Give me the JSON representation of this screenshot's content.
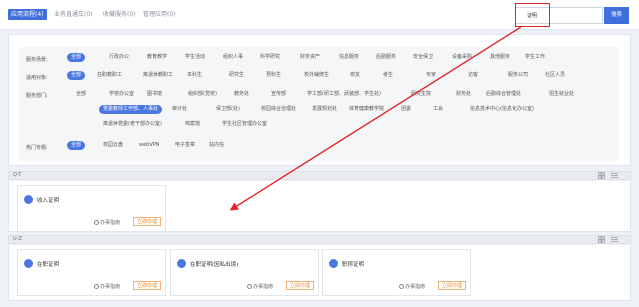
{
  "tabs": [
    {
      "label": "应用流程(4)"
    },
    {
      "label": "业务直通车(0)"
    },
    {
      "label": "收藏服务(0)"
    },
    {
      "label": "管理应用(0)"
    }
  ],
  "search": {
    "value": "证明",
    "button_label": "搜索"
  },
  "filters": {
    "scene_label": "服务场景:",
    "scene_items": [
      "全部",
      "行政办公",
      "教育教学",
      "学生活动",
      "组织人事",
      "科学研究",
      "财务资产",
      "信息服务",
      "后勤服务",
      "安全保卫",
      "设备采购",
      "其他服务",
      "学生工作"
    ],
    "target_label": "适用对象:",
    "target_items": [
      "全部",
      "在职教职工",
      "离退休教职工",
      "本科生",
      "研究生",
      "预科生",
      "校外辅修生",
      "校友",
      "考生",
      "专家",
      "访客",
      "服务公司",
      "社区人员"
    ],
    "dept_label": "服务部门:",
    "dept_row1": [
      "全部",
      "学校办公室",
      "图书馆",
      "组织部(党校)",
      "教务处",
      "宣传部",
      "学工部(研工部、武装部、学生处)",
      "研究生院",
      "财务处",
      "后勤综合管理处",
      "招生就业处"
    ],
    "dept_row2": [
      "党委教师工作部、人事处",
      "审计处",
      "保卫部(处)",
      "校园综合治理处",
      "发展规划处",
      "体育健康教学院",
      "团委",
      "工会",
      "信息技术中心(信息化办公室)"
    ],
    "dept_row3": [
      "离退休党委(老干部办公室)",
      "档案馆",
      "学生社区管理办公室"
    ],
    "hot_label": "热门专题:",
    "hot_items": [
      "全部",
      "校园云盘",
      "webVPN",
      "电子签章",
      "站内信"
    ]
  },
  "sections": [
    {
      "title": "Q-T",
      "cards": [
        {
          "title": "收入证明",
          "guide": "办事指南",
          "apply": "立即办理"
        }
      ]
    },
    {
      "title": "U-Z",
      "cards": [
        {
          "title": "在职证明",
          "guide": "办事指南",
          "apply": "立即办理"
        },
        {
          "title": "在职证明(因私出境)",
          "guide": "办事指南",
          "apply": "立即办理"
        },
        {
          "title": "职称证明",
          "guide": "办事指南",
          "apply": "立即办理"
        }
      ]
    }
  ],
  "colors": {
    "primary": "#3f6fdd",
    "highlight": "#e0262b",
    "apply": "#f08a2e"
  }
}
